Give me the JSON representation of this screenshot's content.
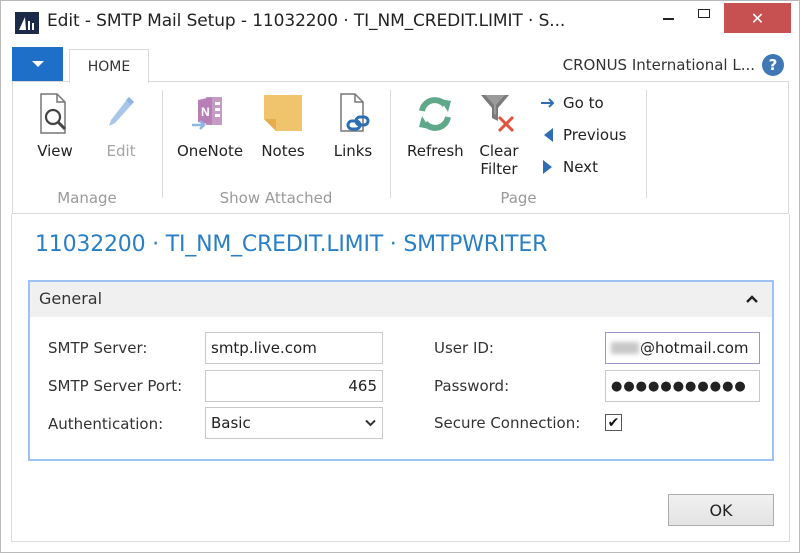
{
  "window": {
    "title": "Edit - SMTP Mail Setup - 11032200 · TI_NM_CREDIT.LIMIT · S...",
    "icons": {
      "app": "dynamics-nav-logo-icon",
      "minimize": "minimize-icon",
      "maximize": "maximize-icon",
      "close": "close-icon"
    },
    "close_glyph": "✕"
  },
  "ribbon": {
    "app_menu_icon": "chevron-down-icon",
    "tabs": [
      {
        "label": "HOME",
        "active": true
      }
    ],
    "company": "CRONUS International L...",
    "help_glyph": "?",
    "groups": [
      {
        "label": "Manage",
        "buttons": [
          {
            "label": "View",
            "icon": "view-document-icon",
            "enabled": true
          },
          {
            "label": "Edit",
            "icon": "pencil-icon",
            "enabled": false
          }
        ]
      },
      {
        "label": "Show Attached",
        "buttons": [
          {
            "label": "OneNote",
            "icon": "onenote-icon",
            "enabled": false
          },
          {
            "label": "Notes",
            "icon": "sticky-note-icon",
            "enabled": true
          },
          {
            "label": "Links",
            "icon": "document-link-icon",
            "enabled": true
          }
        ]
      },
      {
        "label": "Page",
        "buttons": [
          {
            "label": "Refresh",
            "icon": "refresh-icon",
            "enabled": true
          },
          {
            "label": "Clear Filter",
            "label_line1": "Clear",
            "label_line2": "Filter",
            "icon": "clear-filter-icon",
            "enabled": true
          }
        ],
        "small_buttons": [
          {
            "label": "Go to",
            "icon": "arrow-right-icon"
          },
          {
            "label": "Previous",
            "icon": "triangle-left-icon"
          },
          {
            "label": "Next",
            "icon": "triangle-right-icon"
          }
        ]
      }
    ]
  },
  "page": {
    "title": "11032200 · TI_NM_CREDIT.LIMIT · SMTPWRITER"
  },
  "general": {
    "title": "General",
    "collapse_glyph": "⌃",
    "fields": {
      "smtp_server": {
        "label": "SMTP Server:",
        "value": "smtp.live.com"
      },
      "smtp_server_port": {
        "label": "SMTP Server Port:",
        "value": "465"
      },
      "authentication": {
        "label": "Authentication:",
        "value": "Basic",
        "chevron": "⌄"
      },
      "user_id": {
        "label": "User ID:",
        "value_visible": "@hotmail.com",
        "value_redacted": true
      },
      "password": {
        "label": "Password:",
        "value": "●●●●●●●●●●●"
      },
      "secure_connection": {
        "label": "Secure Connection:",
        "checked": true,
        "glyph": "✔"
      }
    }
  },
  "footer": {
    "ok_label": "OK"
  },
  "colors": {
    "accent_blue": "#1e6fc8",
    "title_blue": "#2a7fc4",
    "close_red": "#c75050",
    "fasttab_border": "#9cc3f3",
    "notes_yellow": "#f0c36d",
    "onenote_purple": "#b67fb5",
    "refresh_green": "#5fa88a",
    "clear_red": "#e0533e"
  }
}
